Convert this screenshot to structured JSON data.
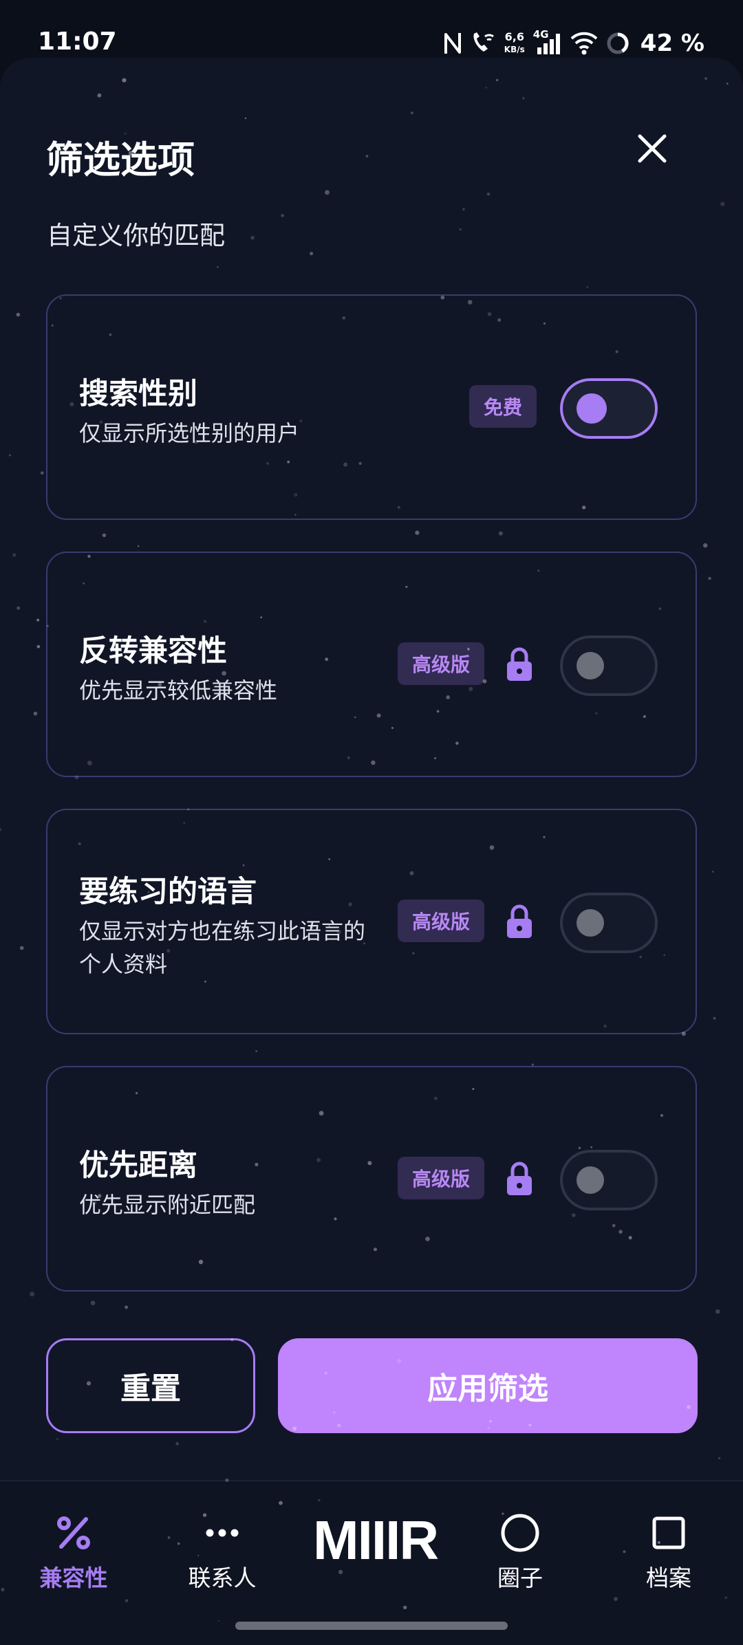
{
  "status_bar": {
    "time": "11:07",
    "net_speed_value": "6,6",
    "net_speed_unit": "KB/s",
    "network_type": "4G",
    "battery": "42 %"
  },
  "sheet": {
    "title": "筛选选项",
    "subtitle": "自定义你的匹配",
    "close_icon": "close-icon"
  },
  "filters": [
    {
      "title": "搜索性别",
      "desc": "仅显示所选性别的用户",
      "badge": "免费",
      "locked": false,
      "enabled": true
    },
    {
      "title": "反转兼容性",
      "desc": "优先显示较低兼容性",
      "badge": "高级版",
      "locked": true,
      "enabled": false
    },
    {
      "title": "要练习的语言",
      "desc": "仅显示对方也在练习此语言的个人资料",
      "badge": "高级版",
      "locked": true,
      "enabled": false
    },
    {
      "title": "优先距离",
      "desc": "优先显示附近匹配",
      "badge": "高级版",
      "locked": true,
      "enabled": false
    }
  ],
  "actions": {
    "reset": "重置",
    "apply": "应用筛选"
  },
  "nav": {
    "items": [
      {
        "label": "兼容性",
        "icon": "percent-icon",
        "active": true
      },
      {
        "label": "联系人",
        "icon": "more-dots-icon",
        "active": false
      },
      {
        "label": "圈子",
        "icon": "circle-icon",
        "active": false
      },
      {
        "label": "档案",
        "icon": "square-icon",
        "active": false
      }
    ],
    "logo": "MIIIR"
  },
  "colors": {
    "accent": "#a67df2",
    "apply_button": "#c084fc",
    "background": "#111627",
    "card_border": "#383c6e",
    "badge_bg": "#322b52"
  }
}
